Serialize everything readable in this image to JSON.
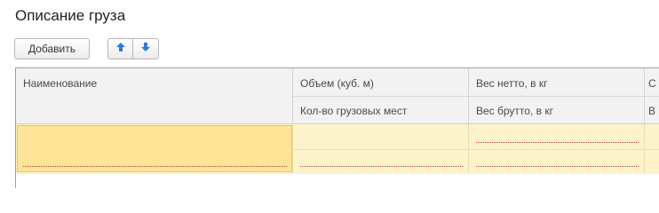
{
  "form": {
    "title": "Описание груза"
  },
  "toolbar": {
    "add_label": "Добавить",
    "up_icon": "arrow-up-icon",
    "down_icon": "arrow-down-icon"
  },
  "table": {
    "columns": {
      "name": "Наименование",
      "volume": "Объем (куб. м)",
      "places": "Кол-во грузовых мест",
      "net": "Вес нетто, в кг",
      "gross": "Вес брутто, в кг",
      "extra_top": "С",
      "extra_bottom": "В"
    },
    "rows": [
      {
        "name": "",
        "volume": "",
        "places": "",
        "net": "",
        "gross": ""
      }
    ]
  },
  "colors": {
    "accent_selected": "#fde497",
    "row_background": "#fdf3cb",
    "arrow": "#2f7bd6"
  }
}
